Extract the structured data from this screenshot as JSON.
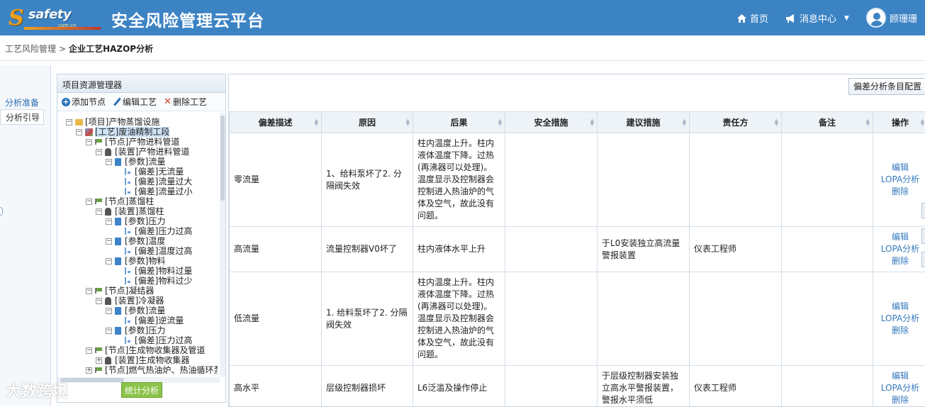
{
  "header": {
    "logo_mark": "S",
    "logo_text": "safety",
    "logo_sub": "com.cn",
    "title": "安全风险管理云平台",
    "nav_home": "首页",
    "nav_messages": "消息中心",
    "user_name": "顾珊珊"
  },
  "breadcrumb": {
    "parent": "工艺风险管理",
    "separator": ">",
    "current": "企业工艺HAZOP分析"
  },
  "side_tabs": {
    "prepare": "分析准备",
    "guide": "分析引导"
  },
  "explorer": {
    "title": "项目资源管理器",
    "add_node": "添加节点",
    "edit_process": "编辑工艺",
    "delete_process": "删除工艺",
    "stat_button": "统计分析",
    "tree": [
      {
        "label": "[项目]产物蒸馏设施",
        "icon": "folder-icon",
        "toggle": "−",
        "indent": 0
      },
      {
        "label": "[工艺]废油精制工段",
        "icon": "process-icon",
        "toggle": "−",
        "indent": 1,
        "selected": true
      },
      {
        "label": "[节点]产物进料管道",
        "icon": "node-flag-icon",
        "toggle": "−",
        "indent": 2
      },
      {
        "label": "[装置]产物进料管道",
        "icon": "device-icon",
        "toggle": "−",
        "indent": 3
      },
      {
        "label": "[参数]流量",
        "icon": "parameter-icon",
        "toggle": "−",
        "indent": 4
      },
      {
        "label": "[偏差]无流量",
        "icon": "deviation-icon",
        "toggle": "",
        "indent": 5
      },
      {
        "label": "[偏差]流量过大",
        "icon": "deviation-icon",
        "toggle": "",
        "indent": 5
      },
      {
        "label": "[偏差]流量过小",
        "icon": "deviation-icon",
        "toggle": "",
        "indent": 5
      },
      {
        "label": "[节点]蒸馏柱",
        "icon": "node-flag-icon",
        "toggle": "−",
        "indent": 2
      },
      {
        "label": "[装置]蒸馏柱",
        "icon": "device-icon",
        "toggle": "−",
        "indent": 3
      },
      {
        "label": "[参数]压力",
        "icon": "parameter-icon",
        "toggle": "−",
        "indent": 4
      },
      {
        "label": "[偏差]压力过高",
        "icon": "deviation-icon",
        "toggle": "",
        "indent": 5
      },
      {
        "label": "[参数]温度",
        "icon": "parameter-icon",
        "toggle": "−",
        "indent": 4
      },
      {
        "label": "[偏差]温度过高",
        "icon": "deviation-icon",
        "toggle": "",
        "indent": 5
      },
      {
        "label": "[参数]物料",
        "icon": "parameter-icon",
        "toggle": "−",
        "indent": 4
      },
      {
        "label": "[偏差]物料过量",
        "icon": "deviation-icon",
        "toggle": "",
        "indent": 5
      },
      {
        "label": "[偏差]物料过少",
        "icon": "deviation-icon",
        "toggle": "",
        "indent": 5
      },
      {
        "label": "[节点]凝结器",
        "icon": "node-flag-icon",
        "toggle": "−",
        "indent": 2
      },
      {
        "label": "[装置]冷凝器",
        "icon": "device-icon",
        "toggle": "−",
        "indent": 3
      },
      {
        "label": "[参数]流量",
        "icon": "parameter-icon",
        "toggle": "−",
        "indent": 4
      },
      {
        "label": "[偏差]逆流量",
        "icon": "deviation-icon",
        "toggle": "",
        "indent": 5
      },
      {
        "label": "[参数]压力",
        "icon": "parameter-icon",
        "toggle": "−",
        "indent": 4
      },
      {
        "label": "[偏差]压力过高",
        "icon": "deviation-icon",
        "toggle": "",
        "indent": 5
      },
      {
        "label": "[节点]生成物收集器及管道",
        "icon": "node-flag-icon",
        "toggle": "−",
        "indent": 2
      },
      {
        "label": "[装置]生成物收集器",
        "icon": "device-icon",
        "toggle": "+",
        "indent": 3
      },
      {
        "label": "[节点]燃气热油炉、热油循环泵",
        "icon": "node-flag-icon",
        "toggle": "+",
        "indent": 2
      }
    ]
  },
  "main": {
    "config_button": "偏差分析条目配置",
    "columns": [
      "偏差描述",
      "原因",
      "后果",
      "安全措施",
      "建议措施",
      "责任方",
      "备注",
      "操作"
    ],
    "op_edit": "编辑",
    "op_lopa": "LOPA分析",
    "op_delete": "删除",
    "rows": [
      {
        "deviation": "零流量",
        "cause": "1、给料泵坏了2. 分隔阀失效",
        "consequence": "柱内温度上升。柱内液体温度下降。过热(再沸器可以处理)。温度显示及控制器会控制进入热油炉的气体及空气，故此没有问题。",
        "safety": "",
        "suggestion": "",
        "owner": "",
        "remark": ""
      },
      {
        "deviation": "高流量",
        "cause": "流量控制器V0坏了",
        "consequence": "柱内液体水平上升",
        "safety": "",
        "suggestion": "于L0安装独立高流量警报装置",
        "owner": "仪表工程师",
        "remark": ""
      },
      {
        "deviation": "低流量",
        "cause": "1. 给料泵坏了2. 分隔阀失效",
        "consequence": "柱内温度上升。柱内液体温度下降。过热(再沸器可以处理)。温度显示及控制器会控制进入热油炉的气体及空气，故此没有问题。",
        "safety": "",
        "suggestion": "",
        "owner": "",
        "remark": ""
      },
      {
        "deviation": "高水平",
        "cause": "层级控制器损坏",
        "consequence": "L6泛滥及操作停止",
        "safety": "",
        "suggestion": "于层级控制器安装独立高水平警报装置，警报水平须低",
        "owner": "仪表工程师",
        "remark": ""
      }
    ]
  },
  "watermark": "大数跨境",
  "colors": {
    "header_bg": "#3c83c4",
    "link": "#3478bc",
    "stat_button": "#8bc34a"
  }
}
